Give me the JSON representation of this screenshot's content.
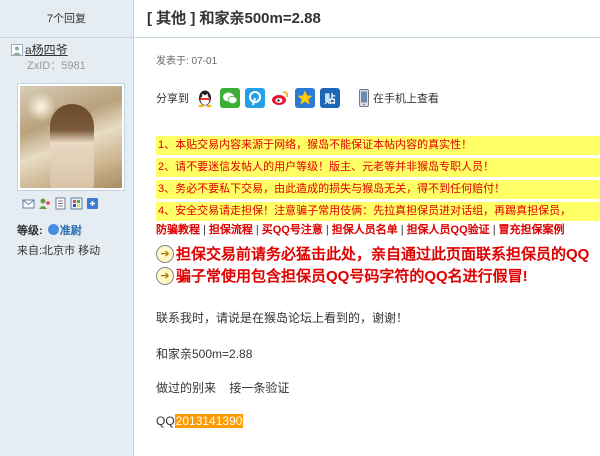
{
  "sidebar": {
    "reply_count": "7个回复",
    "author": "a杨四爷",
    "zxid": "ZxID：5981",
    "level_label": "等级:",
    "level_value": "准尉",
    "source": "来自:北京市 移动"
  },
  "post": {
    "title": "[ 其他 ] 和家亲500m=2.88",
    "posted": "发表于: 07-01",
    "share_label": "分享到",
    "mobile_label": "在手机上查看"
  },
  "notices": [
    "1、本贴交易内容来源于网络，猴岛不能保证本帖内容的真实性！",
    "2、请不要迷信发帖人的用户等级！版主、元老等并非猴岛专职人员！",
    "3、务必不要私下交易，由此造成的损失与猴岛无关，得不到任何赔付！",
    "4、安全交易请走担保！注意骗子常用伎俩：先拉真担保员进对话组，再踢真担保员，"
  ],
  "links": [
    "防骗教程",
    "担保流程",
    "买QQ号注意",
    "担保人员名单",
    "担保人员QQ验证",
    "冒充担保案例"
  ],
  "warnings": [
    "担保交易前请务必猛击此处，亲自通过此页面联系担保员的QQ",
    "骗子常使用包含担保员QQ号码字符的QQ名进行假冒!"
  ],
  "content": {
    "contact": "联系我时，请说是在猴岛论坛上看到的，谢谢！",
    "product": "和家亲500m=2.88",
    "note": "做过的别来    接一条验证",
    "qq_prefix": "QQ",
    "qq_number": "2013141390"
  },
  "colors": {
    "sidebar_bg": "#e5edf2",
    "border": "#c2d5e3",
    "warning_red": "#e00000",
    "notice_bg": "#ffff66",
    "qq_highlight": "#ff9a00"
  },
  "icons": [
    "user-icon",
    "message-icon",
    "add-friend-icon",
    "profile-icon",
    "photo-icon",
    "share-icon",
    "qq-icon",
    "wechat-icon",
    "tencent-weibo-icon",
    "sina-weibo-icon",
    "qzone-icon",
    "renren-icon",
    "mobile-phone-icon",
    "arrow-icon"
  ]
}
